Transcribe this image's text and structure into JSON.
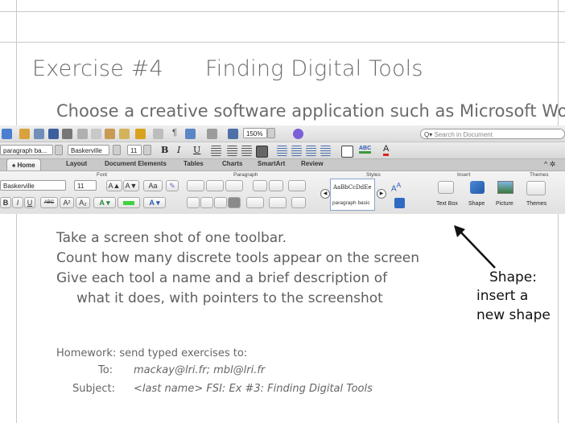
{
  "slide": {
    "title_number": "Exercise #4",
    "title_text": "Finding Digital Tools",
    "subtitle": "Choose a creative software application such as Microsoft Word"
  },
  "ribbon": {
    "zoom": "150%",
    "search_placeholder": "Search in Document",
    "style_value": "paragraph ba...",
    "font_value": "Baskerville",
    "size_value": "11",
    "font_value2": "Baskerville",
    "size_value2": "11",
    "tabs": [
      "Home",
      "Layout",
      "Document Elements",
      "Tables",
      "Charts",
      "SmartArt",
      "Review"
    ],
    "groups": [
      "Font",
      "Paragraph",
      "Styles",
      "Insert",
      "Themes"
    ],
    "style_preview": "AaBbCcDdEe",
    "style_name": "paragraph basic",
    "insert_buttons": [
      "Text Box",
      "Shape",
      "Picture"
    ],
    "themes_button": "Themes",
    "glyphs": {
      "bold": "B",
      "italic": "I",
      "underline": "U",
      "strike": "ABC",
      "superscript": "A²",
      "subscript": "A₂",
      "grow": "A▲",
      "shrink": "A▼",
      "change_case": "Aa",
      "pilcrow": "¶",
      "highlight": "ABC",
      "font_color": "A"
    }
  },
  "instructions": [
    "Take a screen shot of one toolbar.",
    "Count how many discrete tools appear on the screen",
    "Give each tool a name and a brief description of",
    "what it does, with pointers to the screenshot"
  ],
  "annotation": {
    "lines": [
      "Shape:",
      "insert a",
      "new shape"
    ]
  },
  "homework": {
    "intro": "Homework: send typed exercises to:",
    "to_label": "To:",
    "to_value": "mackay@lri.fr; mbl@lri.fr",
    "subject_label": "Subject:",
    "subject_value": "<last name> FSI: Ex #3: Finding Digital Tools"
  },
  "colors": {
    "accent_blue": "#2b5bb5",
    "green": "#3a9a3a"
  }
}
